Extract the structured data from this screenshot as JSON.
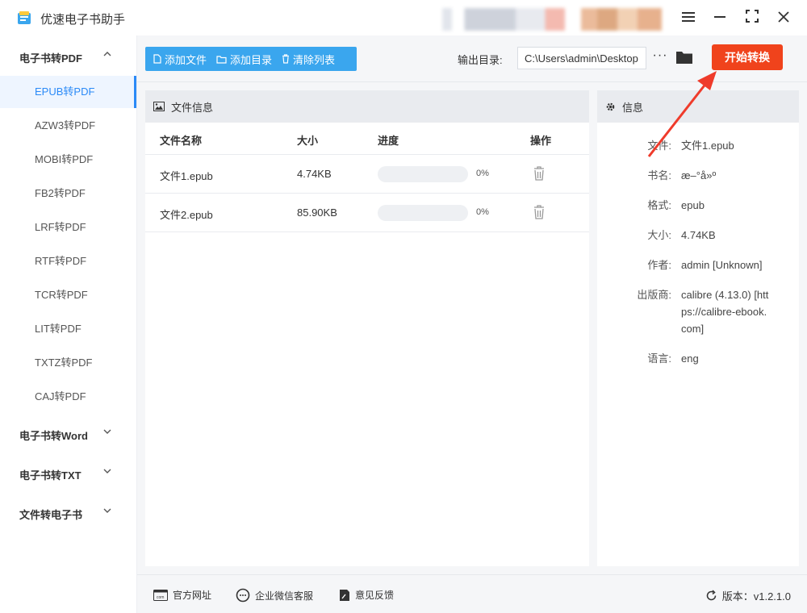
{
  "app": {
    "title": "优速电子书助手",
    "accent_color": "#2b8af7",
    "start_color": "#f0431c"
  },
  "sidebar": {
    "groups": [
      {
        "label": "电子书转PDF",
        "expanded": true,
        "items": [
          "EPUB转PDF",
          "AZW3转PDF",
          "MOBI转PDF",
          "FB2转PDF",
          "LRF转PDF",
          "RTF转PDF",
          "TCR转PDF",
          "LIT转PDF",
          "TXTZ转PDF",
          "CAJ转PDF"
        ],
        "active_item": "EPUB转PDF"
      },
      {
        "label": "电子书转Word",
        "expanded": false
      },
      {
        "label": "电子书转TXT",
        "expanded": false
      },
      {
        "label": "文件转电子书",
        "expanded": false
      }
    ]
  },
  "toolbar": {
    "add_file": "添加文件",
    "add_dir": "添加目录",
    "clear_list": "清除列表",
    "output_label": "输出目录:",
    "output_path": "C:\\Users\\admin\\Desktop",
    "more": "···",
    "start": "开始转换"
  },
  "file_panel": {
    "title": "文件信息",
    "columns": {
      "name": "文件名称",
      "size": "大小",
      "progress": "进度",
      "action": "操作"
    },
    "rows": [
      {
        "name": "文件1.epub",
        "size": "4.74KB",
        "progress_pct": "0%"
      },
      {
        "name": "文件2.epub",
        "size": "85.90KB",
        "progress_pct": "0%"
      }
    ]
  },
  "info_panel": {
    "title": "信息",
    "fields": [
      {
        "label": "文件:",
        "value": "文件1.epub"
      },
      {
        "label": "书名:",
        "value": "æ–°å»º"
      },
      {
        "label": "格式:",
        "value": "epub"
      },
      {
        "label": "大小:",
        "value": "4.74KB"
      },
      {
        "label": "作者:",
        "value": "admin [Unknown]"
      },
      {
        "label": "出版商:",
        "value": "calibre (4.13.0) [https://calibre-ebook.com]"
      },
      {
        "label": "语言:",
        "value": "eng"
      }
    ]
  },
  "footer": {
    "website": "官方网址",
    "wechat": "企业微信客服",
    "feedback": "意见反馈",
    "version": "版本：v1.2.1.0"
  }
}
